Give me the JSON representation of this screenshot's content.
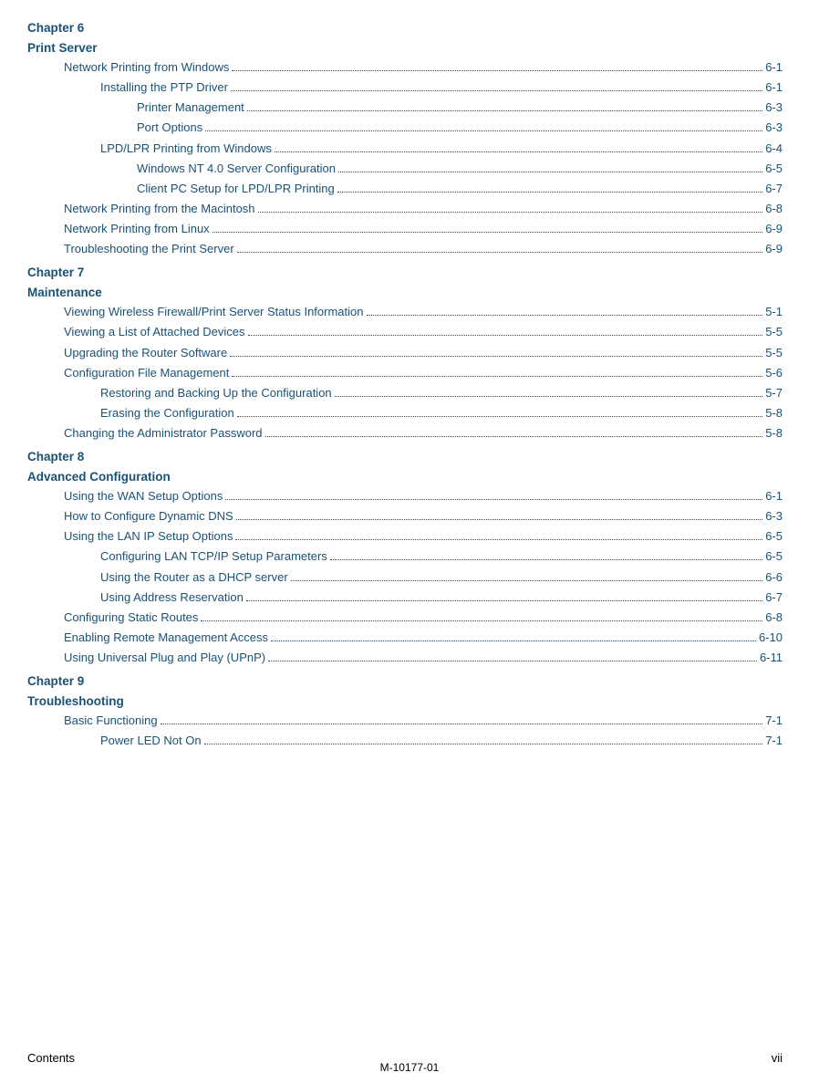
{
  "chapters": [
    {
      "id": "ch6",
      "label": "Chapter 6",
      "title": "Print Server",
      "entries": [
        {
          "indent": 1,
          "text": "Network Printing from Windows",
          "page": "6-1"
        },
        {
          "indent": 2,
          "text": "Installing the PTP Driver",
          "page": "6-1"
        },
        {
          "indent": 3,
          "text": "Printer Management",
          "page": "6-3"
        },
        {
          "indent": 3,
          "text": "Port Options",
          "page": "6-3"
        },
        {
          "indent": 2,
          "text": "LPD/LPR Printing from Windows",
          "page": "6-4"
        },
        {
          "indent": 3,
          "text": "Windows NT 4.0 Server Configuration",
          "page": "6-5"
        },
        {
          "indent": 3,
          "text": "Client PC Setup for LPD/LPR Printing",
          "page": "6-7"
        },
        {
          "indent": 1,
          "text": "Network Printing from the Macintosh",
          "page": "6-8"
        },
        {
          "indent": 1,
          "text": "Network Printing from Linux",
          "page": "6-9"
        },
        {
          "indent": 1,
          "text": "Troubleshooting the Print Server",
          "page": "6-9"
        }
      ]
    },
    {
      "id": "ch7",
      "label": "Chapter 7",
      "title": "Maintenance",
      "entries": [
        {
          "indent": 1,
          "text": "Viewing Wireless Firewall/Print Server Status Information",
          "page": "5-1"
        },
        {
          "indent": 1,
          "text": "Viewing a List of Attached Devices",
          "page": "5-5"
        },
        {
          "indent": 1,
          "text": "Upgrading the Router Software",
          "page": "5-5"
        },
        {
          "indent": 1,
          "text": "Configuration File Management",
          "page": "5-6"
        },
        {
          "indent": 2,
          "text": "Restoring and Backing Up the Configuration",
          "page": "5-7"
        },
        {
          "indent": 2,
          "text": "Erasing the Configuration",
          "page": "5-8"
        },
        {
          "indent": 1,
          "text": "Changing the Administrator Password",
          "page": "5-8"
        }
      ]
    },
    {
      "id": "ch8",
      "label": "Chapter 8",
      "title": "Advanced Configuration",
      "entries": [
        {
          "indent": 1,
          "text": "Using the WAN Setup Options",
          "page": "6-1"
        },
        {
          "indent": 1,
          "text": "How to Configure Dynamic DNS",
          "page": "6-3"
        },
        {
          "indent": 1,
          "text": "Using the LAN IP Setup Options",
          "page": "6-5"
        },
        {
          "indent": 2,
          "text": "Configuring LAN TCP/IP Setup Parameters",
          "page": "6-5"
        },
        {
          "indent": 2,
          "text": "Using the Router as a DHCP server",
          "page": "6-6"
        },
        {
          "indent": 2,
          "text": "Using Address Reservation",
          "page": "6-7"
        },
        {
          "indent": 1,
          "text": "Configuring Static Routes",
          "page": "6-8"
        },
        {
          "indent": 1,
          "text": "Enabling Remote Management Access",
          "page": "6-10"
        },
        {
          "indent": 1,
          "text": "Using Universal Plug and Play (UPnP)",
          "page": "6-11"
        }
      ]
    },
    {
      "id": "ch9",
      "label": "Chapter 9",
      "title": "Troubleshooting",
      "entries": [
        {
          "indent": 1,
          "text": "Basic Functioning",
          "page": "7-1"
        },
        {
          "indent": 2,
          "text": "Power LED Not On",
          "page": "7-1"
        }
      ]
    }
  ],
  "footer": {
    "left": "Contents",
    "right": "vii",
    "center": "M-10177-01"
  }
}
